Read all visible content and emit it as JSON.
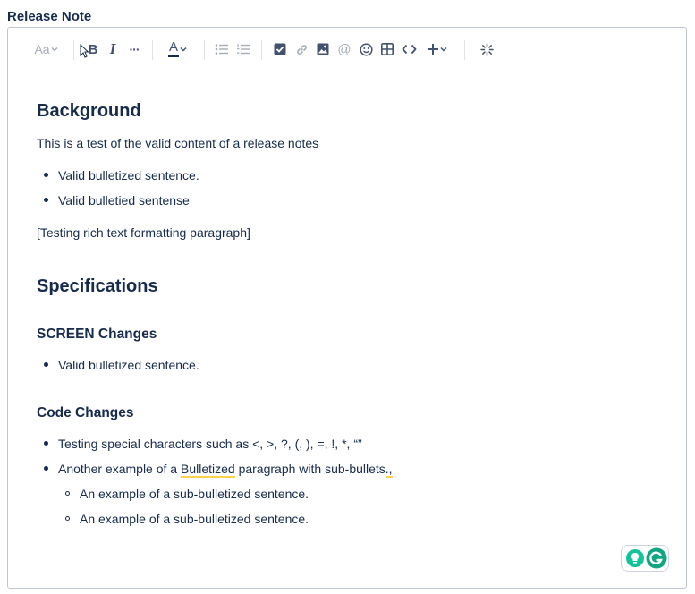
{
  "field": {
    "label": "Release Note"
  },
  "toolbar": {
    "text_style": "Aa",
    "bold": "B",
    "italic": "I",
    "more": "···",
    "text_color": "A"
  },
  "content": {
    "h_background": "Background",
    "p_intro": "This is a test of the valid content of a release notes",
    "bullets_1": [
      "Valid bulletized sentence.",
      "Valid bulletied sentense"
    ],
    "p_testing": "[Testing rich text formatting paragraph]",
    "h_specifications": "Specifications",
    "h_screen": "SCREEN Changes",
    "bullets_screen": [
      "Valid bulletized sentence."
    ],
    "h_code": "Code Changes",
    "bullet_special": "Testing special characters such as <, >, ?, (, ), =, !, *, “”",
    "bullet_another_a": "Another example of a ",
    "bullet_another_b": "Bulletized",
    "bullet_another_c": " paragraph with sub-bullets",
    "bullet_another_d": ".,",
    "sub_bullets": [
      "An example of a sub-bulletized sentence.",
      "An example of a sub-bulletized sentence."
    ]
  },
  "colors": {
    "text": "#172b4d",
    "grammarly_green": "#15c39a",
    "grammarly_dark": "#11a683",
    "underline": "#fcd34d"
  }
}
